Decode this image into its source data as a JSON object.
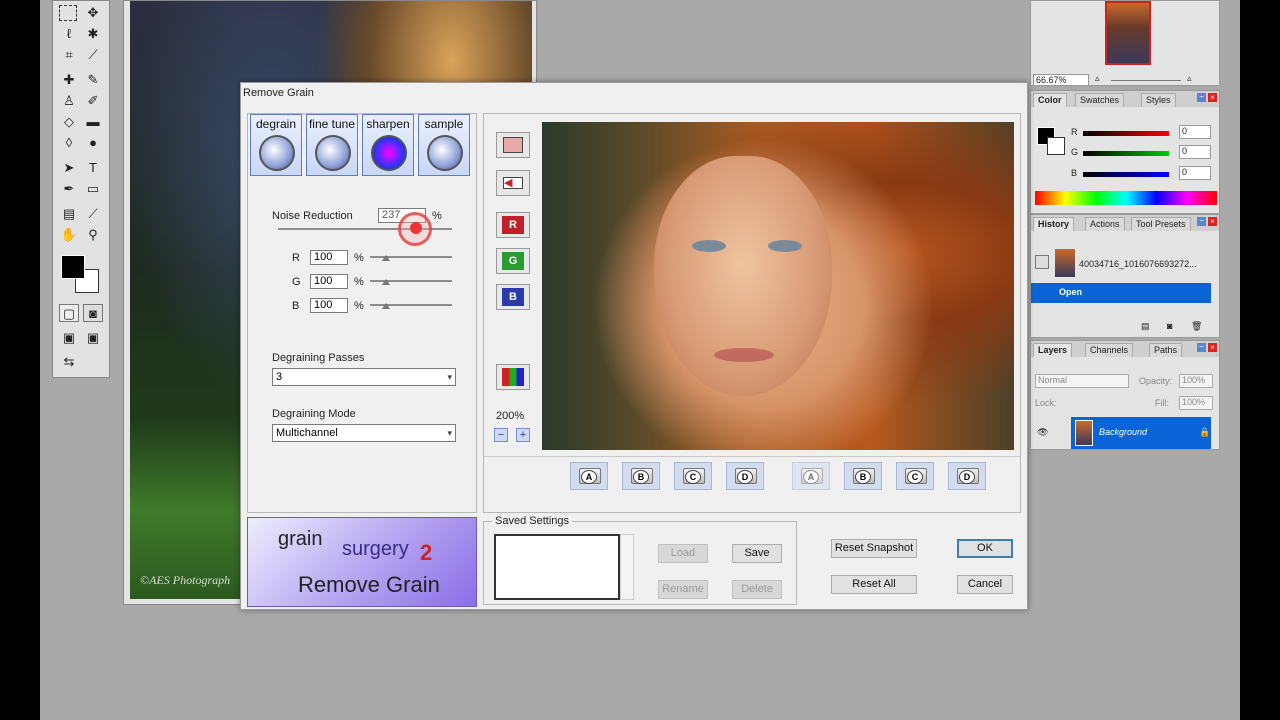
{
  "dialog": {
    "title": "Remove Grain",
    "tabs": [
      {
        "label": "degrain"
      },
      {
        "label": "fine tune"
      },
      {
        "label": "sharpen"
      },
      {
        "label": "sample"
      }
    ],
    "noise_reduction": {
      "label": "Noise Reduction",
      "value": "237",
      "unit": "%"
    },
    "channels": [
      {
        "label": "R",
        "value": "100",
        "unit": "%"
      },
      {
        "label": "G",
        "value": "100",
        "unit": "%"
      },
      {
        "label": "B",
        "value": "100",
        "unit": "%"
      }
    ],
    "degraining_passes": {
      "label": "Degraining Passes",
      "value": "3"
    },
    "degraining_mode": {
      "label": "Degraining Mode",
      "value": "Multichannel"
    },
    "logo": {
      "line1": "grain",
      "line2": "surgery",
      "version": "2",
      "caption": "Remove Grain"
    },
    "side_buttons": [
      {
        "icon": "split-preview-icon"
      },
      {
        "icon": "arrow-left-icon"
      },
      {
        "icon": "channel-r-icon",
        "letter": "R",
        "color": "#c0202a"
      },
      {
        "icon": "channel-g-icon",
        "letter": "G",
        "color": "#2a9a32"
      },
      {
        "icon": "channel-b-icon",
        "letter": "B",
        "color": "#2a3aaa"
      },
      {
        "icon": "rgb-channels-icon"
      }
    ],
    "zoom": {
      "value": "200%",
      "minus": "−",
      "plus": "+"
    },
    "snapshots": [
      "A",
      "B",
      "C",
      "D"
    ],
    "restore_snapshots": [
      "A",
      "B",
      "C",
      "D"
    ],
    "saved_settings": {
      "label": "Saved Settings",
      "load": "Load",
      "save": "Save",
      "rename": "Rename",
      "delete": "Delete"
    },
    "reset_snapshot": "Reset Snapshot",
    "reset_all": "Reset All",
    "ok": "OK",
    "cancel": "Cancel"
  },
  "document": {
    "watermark": "©AES Photograph"
  },
  "navigator": {
    "zoom": "66.67%"
  },
  "color_panel": {
    "tabs": [
      "Color",
      "Swatches",
      "Styles"
    ],
    "r": {
      "label": "R",
      "value": "0"
    },
    "g": {
      "label": "G",
      "value": "0"
    },
    "b": {
      "label": "B",
      "value": "0"
    }
  },
  "history_panel": {
    "tabs": [
      "History",
      "Actions",
      "Tool Presets"
    ],
    "snapshot_name": "40034716_1016076693272...",
    "state": "Open"
  },
  "layers_panel": {
    "tabs": [
      "Layers",
      "Channels",
      "Paths"
    ],
    "blend_mode": "Normal",
    "opacity_label": "Opacity:",
    "opacity": "100%",
    "lock_label": "Lock:",
    "fill_label": "Fill:",
    "fill": "100%",
    "layer_name": "Background"
  },
  "colors": {
    "selection": "#0a64d8",
    "dialog_accent": "#5a7ec0"
  }
}
